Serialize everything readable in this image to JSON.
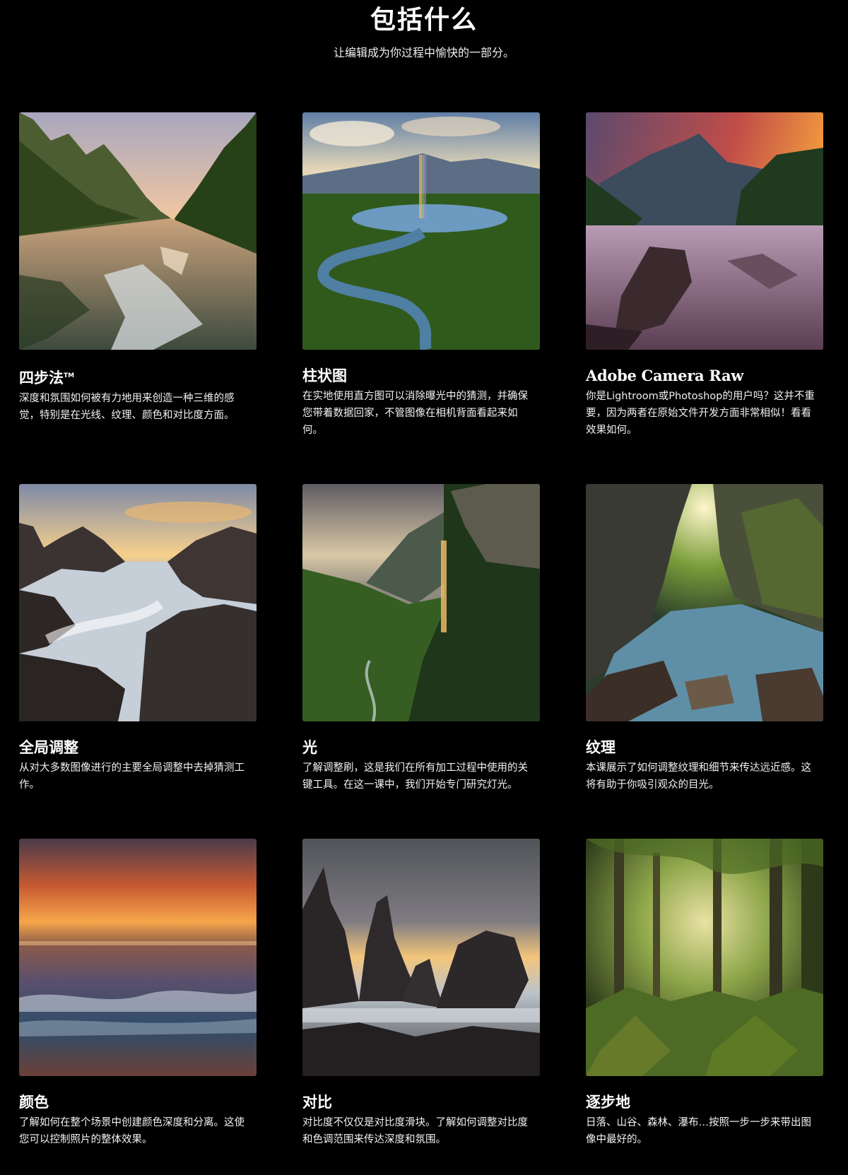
{
  "header": {
    "title": "包括什么",
    "subtitle": "让编辑成为你过程中愉快的一部分。"
  },
  "cards": [
    {
      "title": "四步法",
      "title_mark": "TM",
      "description": "深度和氛围如何被有力地用来创造一种三维的感觉，特别是在光线、纹理、颜色和对比度方面。",
      "image_subject": "fjord-sunset-reflection",
      "colors": [
        "#f2c7a0",
        "#b98a6c",
        "#3f5a2a",
        "#1d2d14",
        "#6f7d82"
      ]
    },
    {
      "title": "柱状图",
      "description": "在实地使用直方图可以消除曝光中的猜测，并确保您带着数据回家，不管图像在相机背面看起来如何。",
      "image_subject": "river-valley-rainbow",
      "colors": [
        "#8fb2d6",
        "#e8d9b8",
        "#5c6e86",
        "#2f5a1c",
        "#4f7fa3"
      ]
    },
    {
      "title": "Adobe Camera Raw",
      "description": "你是Lightroom或Photoshop的用户吗？这并不重要，因为两者在原始文件开发方面非常相似！看看效果如何。",
      "image_subject": "mountain-river-dusk",
      "colors": [
        "#f6a03c",
        "#c04d49",
        "#5b4a6e",
        "#1f3a1f",
        "#8b6c8a"
      ]
    },
    {
      "title": "全局调整",
      "description": "从对大多数图像进行的主要全局调整中去掉猜测工作。",
      "image_subject": "rocky-coast-sunrise",
      "colors": [
        "#f7d08c",
        "#98a5b8",
        "#3b3331",
        "#dfe4ea",
        "#5d5a5e"
      ]
    },
    {
      "title": "光",
      "description": "了解调整刷，这是我们在所有加工过程中使用的关键工具。在这一课中，我们开始专门研究灯光。",
      "image_subject": "waterfall-cliff-valley",
      "colors": [
        "#d9c7a6",
        "#6e6a66",
        "#365e22",
        "#20361a",
        "#e8b867"
      ]
    },
    {
      "title": "纹理",
      "description": "本课展示了如何调整纹理和细节来传达远近感。这将有助于你吸引观众的目光。",
      "image_subject": "canyon-stream-light",
      "colors": [
        "#fff6cc",
        "#7a9d3a",
        "#2b3d2a",
        "#5f8fa6",
        "#3a2e26"
      ]
    },
    {
      "title": "颜色",
      "description": "了解如何在整个场景中创建颜色深度和分离。这使您可以控制照片的整体效果。",
      "image_subject": "ocean-sunset-waves",
      "colors": [
        "#f7a64a",
        "#c75a32",
        "#5b4f6d",
        "#2e4d6a",
        "#8a5a4a"
      ]
    },
    {
      "title": "对比",
      "description": "对比度不仅仅是对比度滑块。了解如何调整对比度和色调范围来传达深度和氛围。",
      "image_subject": "sea-stacks-storm",
      "colors": [
        "#f3c57a",
        "#7f7c82",
        "#2a2628",
        "#bcc3cb",
        "#505458"
      ]
    },
    {
      "title": "逐步地",
      "description": "日落、山谷、森林、瀑布…按照一步一步来带出图像中最好的。",
      "image_subject": "mossy-forest-ferns",
      "colors": [
        "#e9e2a4",
        "#667a2a",
        "#2c3a1a",
        "#4d6b24",
        "#8ea64a"
      ]
    }
  ]
}
